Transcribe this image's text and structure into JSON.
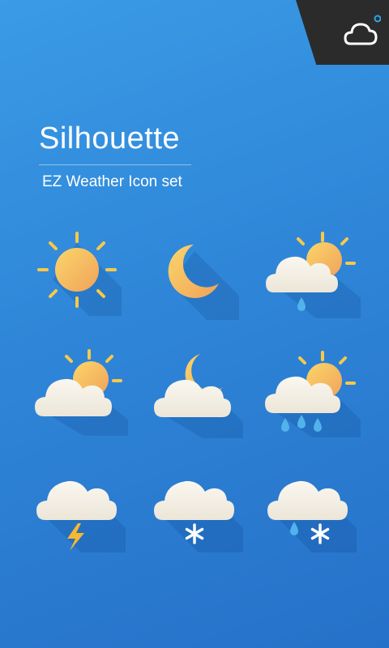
{
  "header": {
    "title": "Silhouette",
    "subtitle": "EZ Weather Icon set",
    "corner_icon": "cloud-icon"
  },
  "colors": {
    "background": "#2f86d8",
    "sun": "#f6b958",
    "ray": "#f7c948",
    "cloud": "#f3efe6",
    "rain": "#52b3ea",
    "snow": "#ffffff",
    "lightning": "#f6b731",
    "corner": "#2b2b2b"
  },
  "icons": [
    {
      "name": "sunny-icon"
    },
    {
      "name": "clear-night-icon"
    },
    {
      "name": "sun-cloud-rain-icon"
    },
    {
      "name": "partly-cloudy-icon"
    },
    {
      "name": "night-cloudy-icon"
    },
    {
      "name": "sun-cloud-heavy-rain-icon"
    },
    {
      "name": "thunderstorm-icon"
    },
    {
      "name": "snow-icon"
    },
    {
      "name": "sleet-icon"
    }
  ]
}
